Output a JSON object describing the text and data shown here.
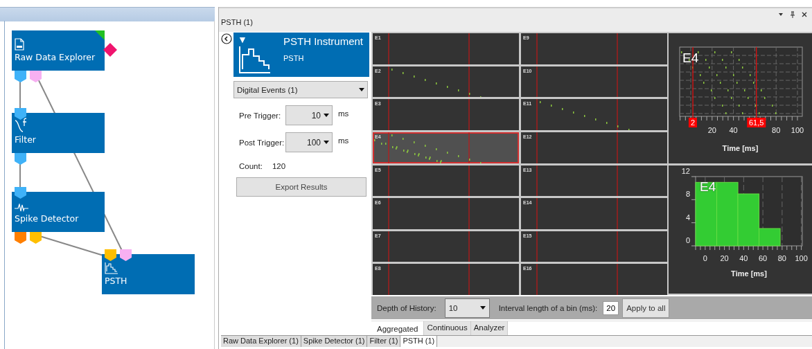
{
  "pipeline": {
    "nodes": [
      {
        "label": "Raw Data Explorer",
        "kind": "source",
        "outputs": [
          {
            "color": "#3fb2f8"
          },
          {
            "color": "#f7b0f2"
          }
        ]
      },
      {
        "label": "Filter",
        "kind": "filter",
        "inputs": [
          {
            "color": "#3fb2f8"
          }
        ],
        "outputs": [
          {
            "color": "#3fb2f8"
          }
        ]
      },
      {
        "label": "Spike Detector",
        "kind": "detector",
        "inputs": [
          {
            "color": "#3fb2f8"
          }
        ],
        "outputs": [
          {
            "color": "#ff7f00"
          },
          {
            "color": "#ffbf00"
          }
        ]
      },
      {
        "label": "PSTH",
        "kind": "instrument",
        "inputs": [
          {
            "color": "#ffbf00"
          },
          {
            "color": "#f7b0f2"
          }
        ]
      }
    ]
  },
  "document": {
    "title": "PSTH (1)"
  },
  "instrument": {
    "toggle": "▼",
    "title": "PSTH Instrument",
    "subtitle": "PSTH",
    "source": "Digital Events (1)",
    "fields": [
      {
        "label": "Pre Trigger:",
        "value": "10",
        "unit": "ms"
      },
      {
        "label": "Post Trigger:",
        "value": "100",
        "unit": "ms"
      }
    ],
    "count_label": "Count:",
    "count_value": "120",
    "export_button": "Export Results"
  },
  "channels": [
    {
      "label": "E1",
      "selected": false,
      "kind": "empty"
    },
    {
      "label": "E9",
      "selected": false,
      "kind": "empty"
    },
    {
      "label": "E2",
      "selected": false,
      "kind": "sparse"
    },
    {
      "label": "E10",
      "selected": false,
      "kind": "empty"
    },
    {
      "label": "E3",
      "selected": false,
      "kind": "empty"
    },
    {
      "label": "E11",
      "selected": false,
      "kind": "sparse"
    },
    {
      "label": "E4",
      "selected": true,
      "kind": "dense"
    },
    {
      "label": "E12",
      "selected": false,
      "kind": "empty"
    },
    {
      "label": "E5",
      "selected": false,
      "kind": "empty"
    },
    {
      "label": "E13",
      "selected": false,
      "kind": "empty"
    },
    {
      "label": "E6",
      "selected": false,
      "kind": "empty"
    },
    {
      "label": "E14",
      "selected": false,
      "kind": "empty"
    },
    {
      "label": "E7",
      "selected": false,
      "kind": "empty"
    },
    {
      "label": "E15",
      "selected": false,
      "kind": "empty"
    },
    {
      "label": "E8",
      "selected": false,
      "kind": "empty"
    },
    {
      "label": "E16",
      "selected": false,
      "kind": "empty"
    }
  ],
  "raster_plot": {
    "channel": "E4",
    "tick_labels": [
      "20",
      "40",
      "80",
      "100"
    ],
    "xlabel": "Time [ms]",
    "cursors": [
      {
        "label": "2"
      },
      {
        "label": "61,5"
      }
    ]
  },
  "histogram": {
    "channel": "E4",
    "chart_data": {
      "type": "bar",
      "xlabel": "Time [ms]",
      "x": [
        1,
        23,
        45,
        67
      ],
      "values": [
        11,
        11,
        9,
        3
      ],
      "xlim": [
        -10,
        101
      ],
      "ylim": [
        0,
        12
      ],
      "xticks": [
        0,
        20,
        40,
        60,
        80,
        100
      ],
      "yticks": [
        0,
        4,
        8,
        12
      ],
      "grid": true
    }
  },
  "bin_settings": {
    "depth_label": "Depth of History:",
    "depth_value": "10",
    "interval_label": "Interval length of a bin (ms):",
    "interval_value": "20",
    "apply_button": "Apply to all"
  },
  "view_tabs": [
    {
      "label": "Aggregated",
      "selected": true
    },
    {
      "label": "Continuous",
      "selected": false
    },
    {
      "label": "Analyzer",
      "selected": false
    }
  ],
  "document_tabs": [
    {
      "label": "Raw Data Explorer (1)",
      "selected": false
    },
    {
      "label": "Spike Detector (1)",
      "selected": false
    },
    {
      "label": "Filter (1)",
      "selected": false
    },
    {
      "label": "PSTH (1)",
      "selected": true
    }
  ]
}
